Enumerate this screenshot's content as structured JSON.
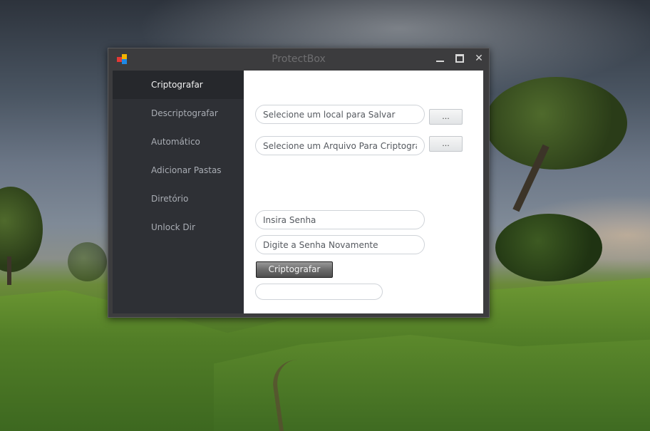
{
  "window": {
    "title": "ProtectBox"
  },
  "controls": {
    "minimize": "minimize",
    "maximize": "maximize",
    "close": "✕"
  },
  "sidebar": {
    "items": [
      {
        "label": "Criptografar",
        "active": true
      },
      {
        "label": "Descriptografar",
        "active": false
      },
      {
        "label": "Automático",
        "active": false
      },
      {
        "label": "Adicionar Pastas",
        "active": false
      },
      {
        "label": "Diretório",
        "active": false
      },
      {
        "label": "Unlock Dir",
        "active": false
      }
    ]
  },
  "form": {
    "save_location": {
      "value": "",
      "placeholder": "Selecione um local para Salvar",
      "browse_label": "..."
    },
    "file_to_encrypt": {
      "value": "",
      "placeholder": "Selecione um Arquivo Para Criptografar",
      "browse_label": "..."
    },
    "password": {
      "value": "",
      "placeholder": "Insira Senha"
    },
    "password_confirm": {
      "value": "",
      "placeholder": "Digite a Senha Novamente"
    },
    "encrypt_button": "Criptografar",
    "status": {
      "value": ""
    }
  },
  "colors": {
    "sidebar_bg": "#2e3035",
    "sidebar_active_bg": "#26282c",
    "window_bg": "#3c3c3e",
    "content_bg": "#ffffff"
  }
}
